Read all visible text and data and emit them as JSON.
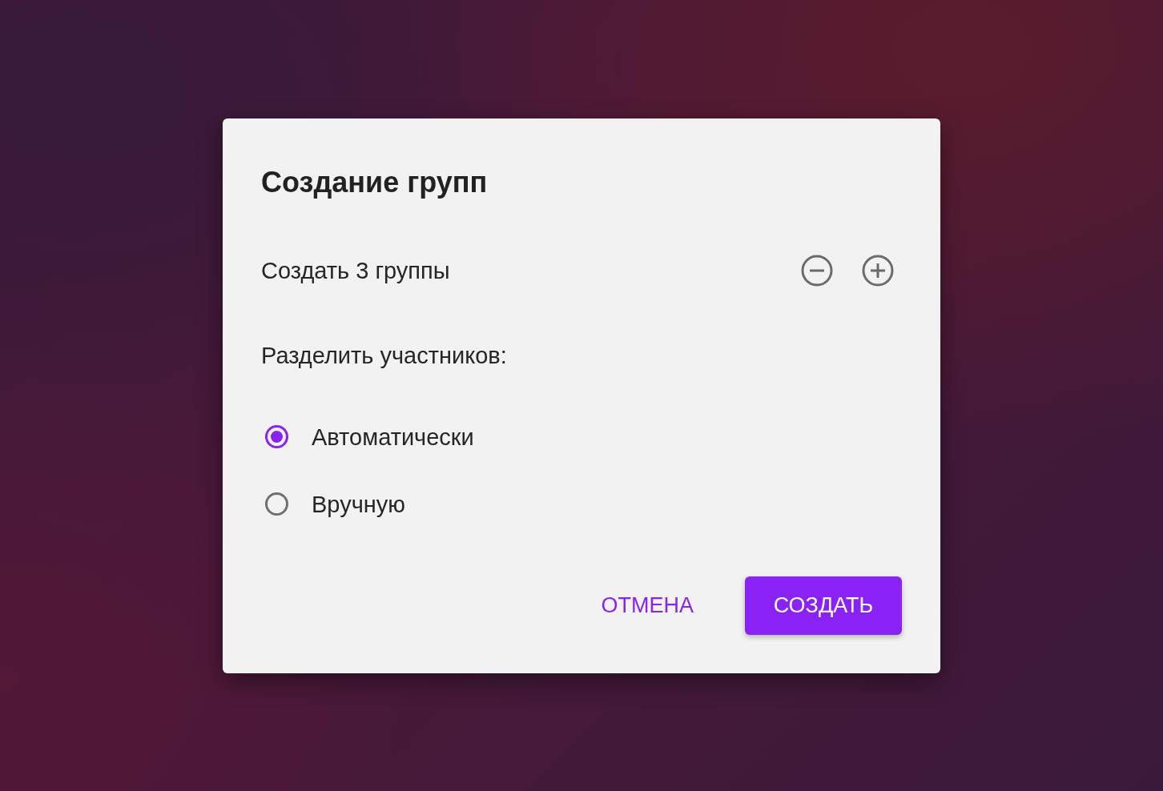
{
  "dialog": {
    "title": "Создание групп",
    "count_label": "Создать 3 группы",
    "split_label": "Разделить участников:",
    "options": [
      {
        "label": "Автоматически",
        "selected": true
      },
      {
        "label": "Вручную",
        "selected": false
      }
    ],
    "buttons": [
      {
        "label": "ОТМЕНА",
        "kind": "text"
      },
      {
        "label": "СОЗДАТЬ",
        "kind": "contained"
      }
    ]
  }
}
